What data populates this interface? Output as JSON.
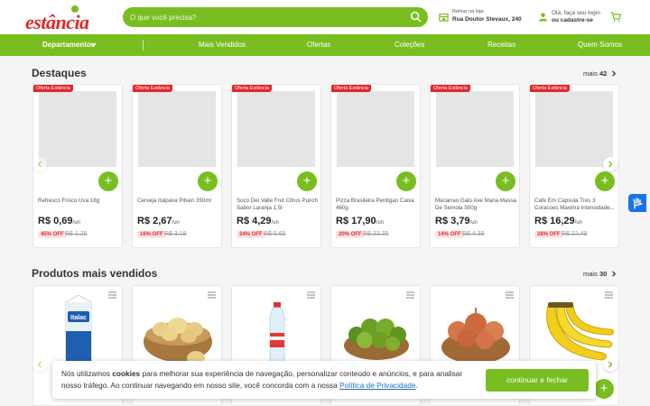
{
  "header": {
    "logo_text": "estância",
    "search_placeholder": "O que você precisa?",
    "store_label": "Retirar na loja:",
    "store_address": "Rua Doutor Stevaux, 240",
    "login_line1": "Olá, faça seu login",
    "login_line2": "ou cadastre-se"
  },
  "nav": {
    "departments": "Departamentos",
    "items": [
      "Mais Vendidos",
      "Ofertas",
      "Coleções",
      "Receitas",
      "Quem Somos"
    ]
  },
  "highlights": {
    "title": "Destaques",
    "more_label": "mais",
    "more_count": "42",
    "products": [
      {
        "badge": "Oferta Estância",
        "name": "Refresco Frisco Uva 18g",
        "price": "R$ 0,69",
        "unit": "/un",
        "discount": "45% OFF",
        "old_price": "R$ 1,25"
      },
      {
        "badge": "Oferta Estância",
        "name": "Cerveja Itaipava Pilsen 350ml",
        "price": "R$ 2,67",
        "unit": "/un",
        "discount": "16% OFF",
        "old_price": "R$ 3,19"
      },
      {
        "badge": "Oferta Estância",
        "name": "Suco Del Valle Frut Citrus Punch Sabor Laranja 1,5l",
        "price": "R$ 4,29",
        "unit": "/un",
        "discount": "24% OFF",
        "old_price": "R$ 5,65"
      },
      {
        "badge": "Oferta Estância",
        "name": "Pizza Brasileira Perdigao Caixa 460g",
        "price": "R$ 17,90",
        "unit": "/un",
        "discount": "20% OFF",
        "old_price": "R$ 22,35"
      },
      {
        "badge": "Oferta Estância",
        "name": "Macarrao Galo Ave Maria Massa De Semola 500g",
        "price": "R$ 3,79",
        "unit": "/un",
        "discount": "14% OFF",
        "old_price": "R$ 4,39"
      },
      {
        "badge": "Oferta Estância",
        "name": "Cafe Em Capsula Tres 3 Coracoes Maxima Intensidade...",
        "price": "R$ 16,29",
        "unit": "/un",
        "discount": "28% OFF",
        "old_price": "R$ 22,49"
      }
    ]
  },
  "best_sellers": {
    "title": "Produtos mais vendidos",
    "more_label": "mais",
    "more_count": "30",
    "milk_brand": "Italac"
  },
  "cookie": {
    "text_before": "Nós utilizamos ",
    "text_bold": "cookies",
    "text_after": " para melhorar sua experiência de navegação, personalizar conteúdo e anúncios, e para analisar nosso tráfego. Ao continuar navegando em nosso site, você concorda com a nossa ",
    "link": "Política de Privacidade",
    "period": ".",
    "button": "continuar e fechar"
  },
  "colors": {
    "brand_green": "#78be20",
    "brand_red": "#e3262a"
  }
}
